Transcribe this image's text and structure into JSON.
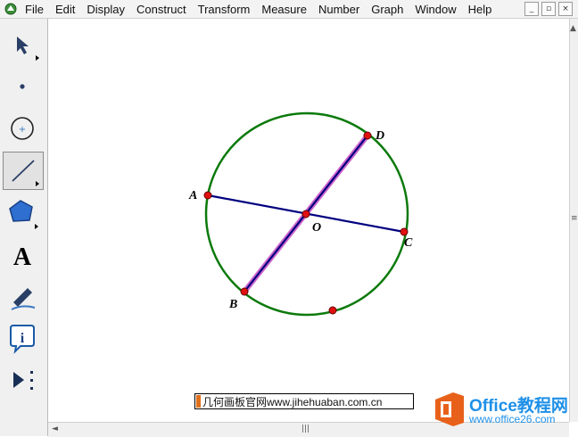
{
  "menu": {
    "items": [
      "File",
      "Edit",
      "Display",
      "Construct",
      "Transform",
      "Measure",
      "Number",
      "Graph",
      "Window",
      "Help"
    ]
  },
  "window_buttons": {
    "minimize": "_",
    "restore": "▫",
    "close": "×"
  },
  "toolbox": {
    "tools": [
      "arrow-tool",
      "point-tool",
      "compass-tool",
      "straightedge-tool",
      "polygon-tool",
      "text-tool",
      "marker-tool",
      "information-tool",
      "custom-tool"
    ],
    "selected": "straightedge-tool",
    "text_tool_glyph": "A"
  },
  "canvas": {
    "points": {
      "A": "A",
      "B": "B",
      "C": "C",
      "D": "D",
      "O": "O"
    }
  },
  "colors": {
    "circle": "#0b7a0b",
    "segment": "#000080",
    "highlight": "#cc66cc",
    "point": "#e01010"
  },
  "watermark": {
    "text": "几何画板官网www.jihehuaban.com.cn"
  },
  "logo": {
    "main": "Office教程网",
    "sub": "www.office26.com"
  }
}
